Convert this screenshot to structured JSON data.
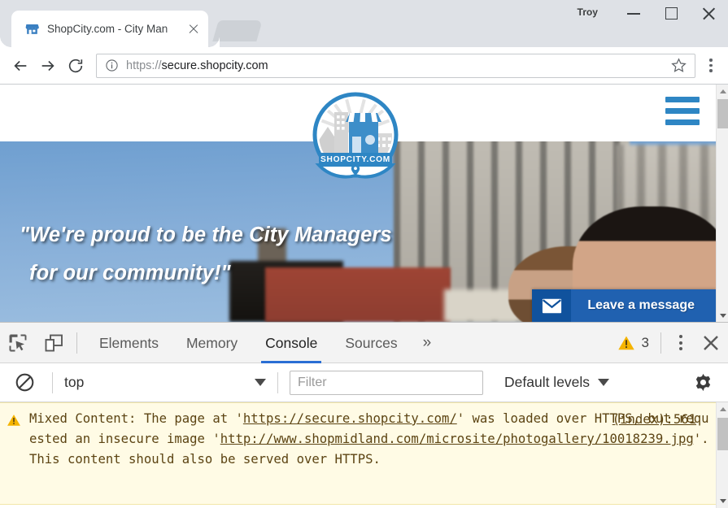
{
  "browser": {
    "profile_name": "Troy",
    "tab": {
      "title": "ShopCity.com - City Man",
      "favicon": "storefront-icon",
      "close": "×"
    },
    "window_controls": {
      "minimize": "minimize-icon",
      "maximize": "maximize-icon",
      "close": "close-icon"
    },
    "omnibox": {
      "scheme": "https://",
      "host": "secure.shopcity.com",
      "full_url": "https://secure.shopcity.com",
      "info_icon": "info-circle-icon",
      "star_icon": "bookmark-star-icon"
    },
    "nav": {
      "back": "back-arrow-icon",
      "forward": "forward-arrow-icon",
      "reload": "reload-icon",
      "menu": "chrome-menu-icon"
    }
  },
  "page": {
    "logo": {
      "brand_text": "SHOPCITY.COM",
      "icon": "shopcity-badge-logo",
      "pin_icon": "location-pin-icon"
    },
    "menu_icon": "hamburger-menu-icon",
    "hero": {
      "line1": "\"We're proud to be the City Managers",
      "line2": "for our community!\""
    },
    "chat_widget": {
      "label": "Leave a message",
      "icon": "envelope-icon"
    }
  },
  "devtools": {
    "toolbar": {
      "inspect_icon": "inspect-element-icon",
      "device_icon": "device-toolbar-icon",
      "more_tabs": "»",
      "warning_count": "3",
      "warning_icon": "warning-triangle-icon",
      "kebab_icon": "more-options-icon",
      "close_icon": "close-devtools-icon"
    },
    "tabs": [
      {
        "label": "Elements",
        "active": false
      },
      {
        "label": "Memory",
        "active": false
      },
      {
        "label": "Console",
        "active": true
      },
      {
        "label": "Sources",
        "active": false
      }
    ],
    "filterbar": {
      "clear_icon": "clear-console-icon",
      "context": "top",
      "filter_placeholder": "Filter",
      "filter_value": "",
      "levels": "Default levels",
      "gear_icon": "settings-gear-icon"
    },
    "console": {
      "message": {
        "level": "warning",
        "source": "(index):561",
        "part1": "Mixed Content: The page at '",
        "link1": "https://secure.shopcity.com/",
        "part2": "' was loaded over HTTPS, but requested an insecure image '",
        "link2": "http://www.shopmidland.com/microsite/photogallery/10018239.jpg",
        "part3": "'. This content should also be served over HTTPS."
      }
    }
  },
  "colors": {
    "accent_blue": "#2e86c4",
    "chat_blue": "#2061b0",
    "warning_yellow": "#f5b400",
    "console_bg": "#fffbe5",
    "console_text": "#5c4413",
    "devtools_active": "#2a6ed4"
  }
}
